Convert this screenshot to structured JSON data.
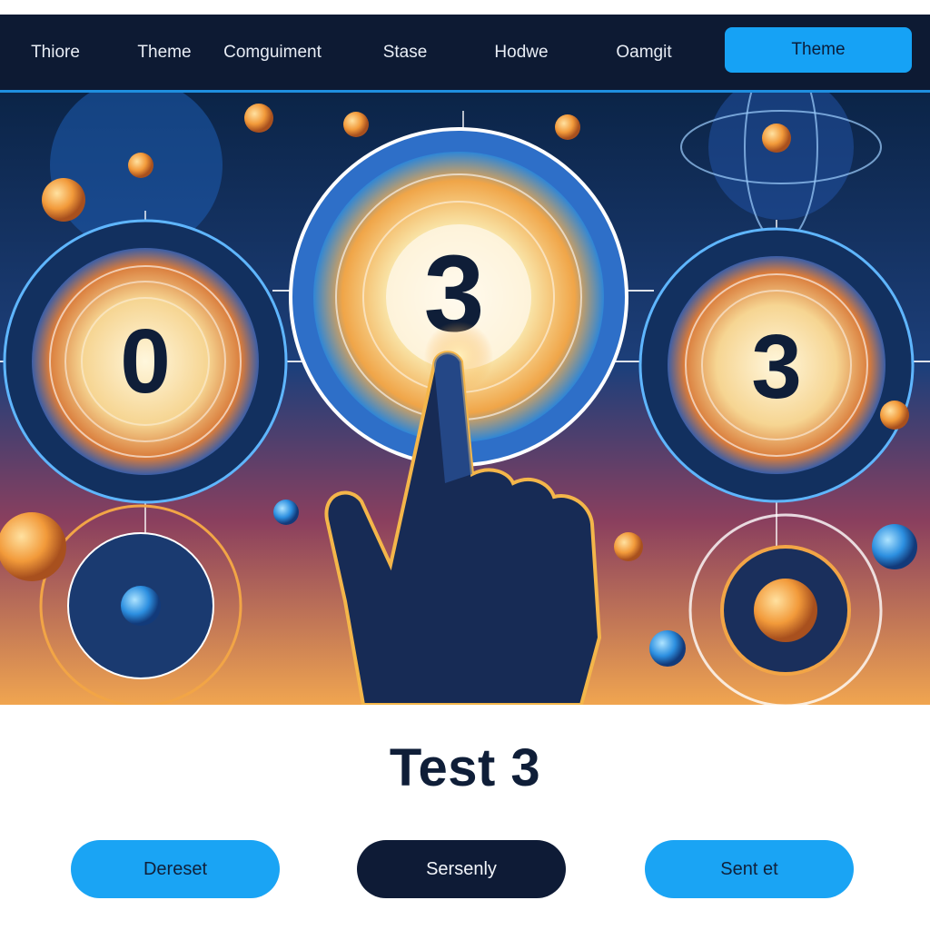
{
  "nav": {
    "items": [
      {
        "label": "Thiore"
      },
      {
        "label": "Theme"
      },
      {
        "label": "Comguiment"
      },
      {
        "label": "Stase"
      },
      {
        "label": "Hodwe"
      },
      {
        "label": "Oamgit"
      },
      {
        "label": "Theme",
        "active": true
      }
    ]
  },
  "hero": {
    "dial_left_digit": "0",
    "dial_center_digit": "3",
    "dial_right_digit": "3"
  },
  "main": {
    "title": "Test 3",
    "buttons": [
      {
        "label": "Dereset",
        "style": "blue"
      },
      {
        "label": "Sersenly",
        "style": "dark"
      },
      {
        "label": "Sent et",
        "style": "blue"
      }
    ]
  },
  "colors": {
    "navbar": "#0d1a33",
    "accent": "#16a2f5",
    "dark_button": "#0e1b36",
    "title": "#0f1e38"
  }
}
